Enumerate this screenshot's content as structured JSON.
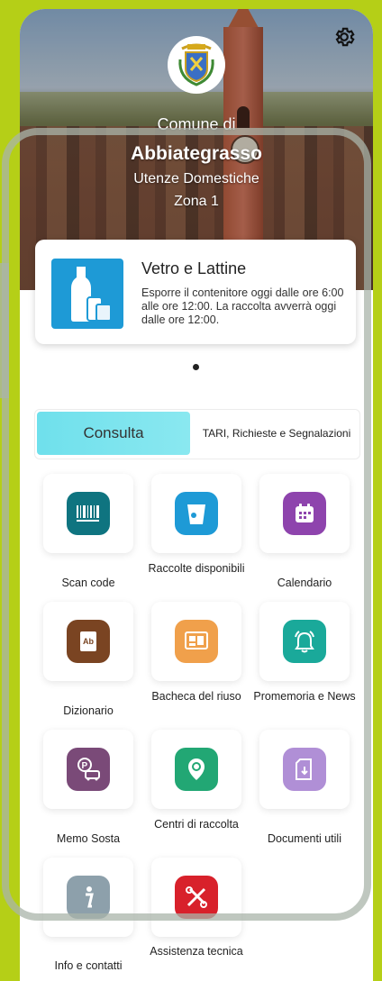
{
  "header": {
    "comune_label": "Comune di",
    "city": "Abbiategrasso",
    "utenze": "Utenze Domestiche",
    "zona": "Zona 1",
    "settings_icon": "gear-icon",
    "crest_icon": "city-crest-icon"
  },
  "collection_card": {
    "title": "Vetro e Lattine",
    "text": "Esporre il contenitore oggi dalle ore 6:00 alle ore 12:00. La raccolta avverrà oggi dalle ore 12:00.",
    "icon": "glass-cans-icon",
    "icon_color": "#1e9ad6"
  },
  "tabs": {
    "active": "Consulta",
    "other": "TARI, Richieste e Segnalazioni"
  },
  "tiles": [
    {
      "label": "Scan code",
      "icon": "barcode-icon",
      "color": "#0f7480"
    },
    {
      "label": "Raccolte disponibili",
      "icon": "bin-icon",
      "color": "#1e9ad6"
    },
    {
      "label": "Calendario",
      "icon": "calendar-icon",
      "color": "#8e44ad"
    },
    {
      "label": "Dizionario",
      "icon": "dictionary-icon",
      "color": "#7a4422"
    },
    {
      "label": "Bacheca del riuso",
      "icon": "board-icon",
      "color": "#f0a04b"
    },
    {
      "label": "Promemoria e News",
      "icon": "bell-icon",
      "color": "#1aa99a"
    },
    {
      "label": "Memo Sosta",
      "icon": "parking-icon",
      "color": "#7a4a78"
    },
    {
      "label": "Centri di raccolta",
      "icon": "map-pin-recycle-icon",
      "color": "#22a774"
    },
    {
      "label": "Documenti utili",
      "icon": "document-icon",
      "color": "#b08fd6"
    },
    {
      "label": "Info e contatti",
      "icon": "info-icon",
      "color": "#8da0ab"
    },
    {
      "label": "Assistenza tecnica",
      "icon": "tools-icon",
      "color": "#d8212b"
    }
  ]
}
